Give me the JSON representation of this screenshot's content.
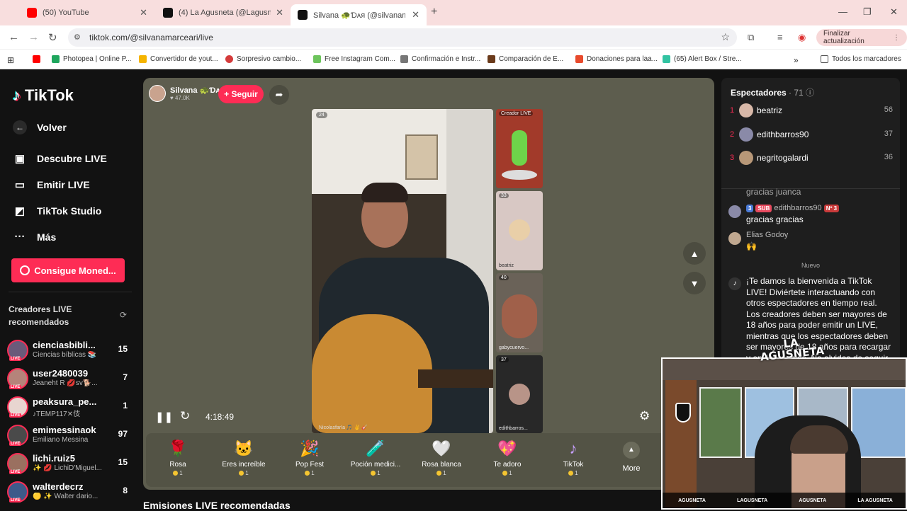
{
  "browser": {
    "tabs": [
      {
        "title": "(50) YouTube",
        "color": "#ff0000"
      },
      {
        "title": "(4) La Agusneta (@Lagusneta) / X",
        "color": "#111111"
      },
      {
        "title": "Silvana 🐢Ɗᴀя (@silvanama",
        "color": "#111111"
      }
    ],
    "url": "tiktok.com/@silvanamarceari/live",
    "update_button": "Finalizar actualización",
    "bookmarks": [
      {
        "label": "",
        "color": "#ff0000"
      },
      {
        "label": "Photopea | Online P...",
        "color": "#1fa65d"
      },
      {
        "label": "Convertidor de yout...",
        "color": "#f5b400"
      },
      {
        "label": "Sorpresivo cambio...",
        "color": "#d43b3b"
      },
      {
        "label": "Free Instagram Com...",
        "color": "#6dc45c"
      },
      {
        "label": "Confirmación e Instr...",
        "color": "#777777"
      },
      {
        "label": "Comparación de E...",
        "color": "#6b3b1b"
      },
      {
        "label": "Donaciones para laa...",
        "color": "#e84a2c"
      },
      {
        "label": "(65) Alert Box / Stre...",
        "color": "#32c3a2"
      }
    ],
    "all_bookmarks": "Todos los marcadores"
  },
  "sidebar": {
    "logo": "TikTok",
    "back": "Volver",
    "nav": [
      {
        "label": "Descubre LIVE",
        "icon": "calendar-live-icon"
      },
      {
        "label": "Emitir LIVE",
        "icon": "camera-icon"
      },
      {
        "label": "TikTok Studio",
        "icon": "studio-icon"
      },
      {
        "label": "Más",
        "icon": "more-dots-icon"
      }
    ],
    "coins_button": "Consigue Moned...",
    "rec_title": "Creadores LIVE recomendados",
    "creators": [
      {
        "name": "cienciasbibli...",
        "sub": "Ciencias bíblicas 📚",
        "count": "15"
      },
      {
        "name": "user2480039",
        "sub": "Jeaneht R 💋sv🐕...",
        "count": "7"
      },
      {
        "name": "peaksura_pe...",
        "sub": "♪TEMP117✕伎",
        "count": "1"
      },
      {
        "name": "emimessinaok",
        "sub": "Emiliano Messina",
        "count": "97"
      },
      {
        "name": "lichi.ruiz5",
        "sub": "✨ 💋 LichiD'Miguel...",
        "count": "15"
      },
      {
        "name": "walterdecrz",
        "sub": "🟡 ✨ Walter dario...",
        "count": "8"
      }
    ],
    "live_badge": "LIVE"
  },
  "player": {
    "host_name": "Silvana 🐢Ɗᴀя",
    "host_likes": "♥ 47.0K",
    "follow": "+ Seguir",
    "video_count": "24",
    "video_tag": "NicolasfarIa 🎵 ✌ 🎸",
    "time": "4:18:49",
    "guests": [
      {
        "label": "Creador LIVE",
        "count": ""
      },
      {
        "label": "beatriz",
        "count": "33"
      },
      {
        "label": "gabycuervo...",
        "count": "40"
      },
      {
        "label": "edithbarros...",
        "count": "37"
      }
    ],
    "gifts": [
      {
        "name": "Rosa",
        "price": "1",
        "icon": "🌹"
      },
      {
        "name": "Eres increíble",
        "price": "1",
        "icon": "🐱"
      },
      {
        "name": "Pop Fest",
        "price": "1",
        "icon": "🎉"
      },
      {
        "name": "Poción medici...",
        "price": "1",
        "icon": "🧪"
      },
      {
        "name": "Rosa blanca",
        "price": "1",
        "icon": "🤍"
      },
      {
        "name": "Te adoro",
        "price": "1",
        "icon": "💖"
      },
      {
        "name": "TikTok",
        "price": "1",
        "icon": "♪"
      }
    ],
    "more": "More",
    "rec_heading": "Emisiones LIVE recomendadas"
  },
  "chat": {
    "viewers_title": "Espectadores",
    "viewers_count": "· 71",
    "viewers": [
      {
        "rank": "1",
        "name": "beatriz",
        "score": "56"
      },
      {
        "rank": "2",
        "name": "edithbarros90",
        "score": "37"
      },
      {
        "rank": "3",
        "name": "negritogalardi",
        "score": "36"
      }
    ],
    "partial_msg": "gracias juanca",
    "messages": [
      {
        "user": "edithbarros90",
        "level": "3",
        "sub": "SUB",
        "rank": "Nº 3",
        "text": "gracias gracias"
      },
      {
        "user": "Elias Godoy",
        "text": "🙌"
      }
    ],
    "new_label": "Nuevo",
    "welcome": "¡Te damos la bienvenida a TikTok LIVE! Diviértete interactuando con otros espectadores en tiempo real. Los creadores deben ser mayores de 18 años para poder emitir un LIVE, mientras que los espectadores deben ser mayores de 18 años para recargar y enviar regalos. No olvides de seguir"
  },
  "webcam": {
    "watermark": "LA AGUSNETA",
    "socials": [
      "AGUSNETA",
      "LAGUSNETA",
      "AGUSNETA",
      "LA AGUSNETA"
    ]
  }
}
